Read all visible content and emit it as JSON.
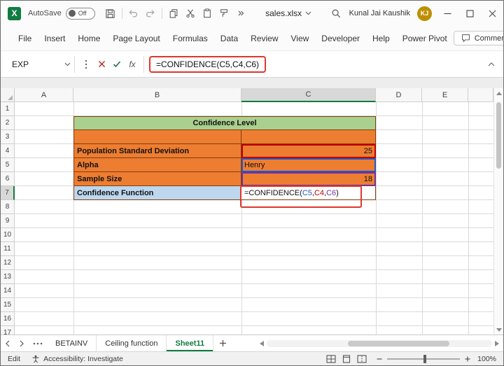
{
  "titlebar": {
    "logo_letter": "X",
    "autosave_label": "AutoSave",
    "autosave_state": "Off",
    "filename": "sales.xlsx",
    "user_name": "Kunal Jai Kaushik",
    "user_initials": "KJ"
  },
  "ribbon": {
    "tabs": [
      {
        "label": "File"
      },
      {
        "label": "Insert"
      },
      {
        "label": "Home"
      },
      {
        "label": "Page Layout"
      },
      {
        "label": "Formulas"
      },
      {
        "label": "Data"
      },
      {
        "label": "Review"
      },
      {
        "label": "View"
      },
      {
        "label": "Developer"
      },
      {
        "label": "Help"
      },
      {
        "label": "Power Pivot"
      }
    ],
    "comments_label": "Comments"
  },
  "formula_bar": {
    "name_box_value": "EXP",
    "fx_label": "fx",
    "formula_text": "=CONFIDENCE(C5,C4,C6)"
  },
  "grid": {
    "column_labels": [
      "A",
      "B",
      "C",
      "D",
      "E"
    ],
    "row_labels": [
      "1",
      "2",
      "3",
      "4",
      "5",
      "6",
      "7",
      "8",
      "9",
      "10",
      "11",
      "12",
      "13",
      "14",
      "15",
      "16",
      "17"
    ],
    "active_column": "C",
    "active_row": "7"
  },
  "table": {
    "title": "Confidence Level",
    "rows": [
      {
        "label": "Population Standard Deviation",
        "value": "25"
      },
      {
        "label": "Alpha",
        "value": "Henry"
      },
      {
        "label": "Sample Size",
        "value": "18"
      },
      {
        "label": "Confidence Function",
        "value": "=CONFIDENCE(C5,C4,C6)"
      }
    ]
  },
  "cell_formula": {
    "parts": [
      {
        "text": "=CONFIDENCE(",
        "color": "#111111"
      },
      {
        "text": "C5",
        "color": "#2457C5"
      },
      {
        "text": ",",
        "color": "#111111"
      },
      {
        "text": "C4",
        "color": "#C00000"
      },
      {
        "text": ",",
        "color": "#111111"
      },
      {
        "text": "C6",
        "color": "#7030A0"
      },
      {
        "text": ")",
        "color": "#111111"
      }
    ]
  },
  "sheet_tabs": {
    "tabs": [
      {
        "label": "BETAINV",
        "active": false
      },
      {
        "label": "Ceiling function",
        "active": false
      },
      {
        "label": "Sheet11",
        "active": true
      }
    ]
  },
  "status_bar": {
    "mode": "Edit",
    "accessibility": "Accessibility: Investigate",
    "zoom": "100%"
  },
  "colors": {
    "orange": "#ED7D31",
    "green_header": "#A9D08E",
    "light_blue": "#BDD7EE",
    "table_border": "#843C0C",
    "annotation_red": "#E0362B",
    "excel_green": "#107C41",
    "ref_blue": "#2457C5",
    "ref_red": "#C00000",
    "ref_purple": "#7030A0"
  }
}
